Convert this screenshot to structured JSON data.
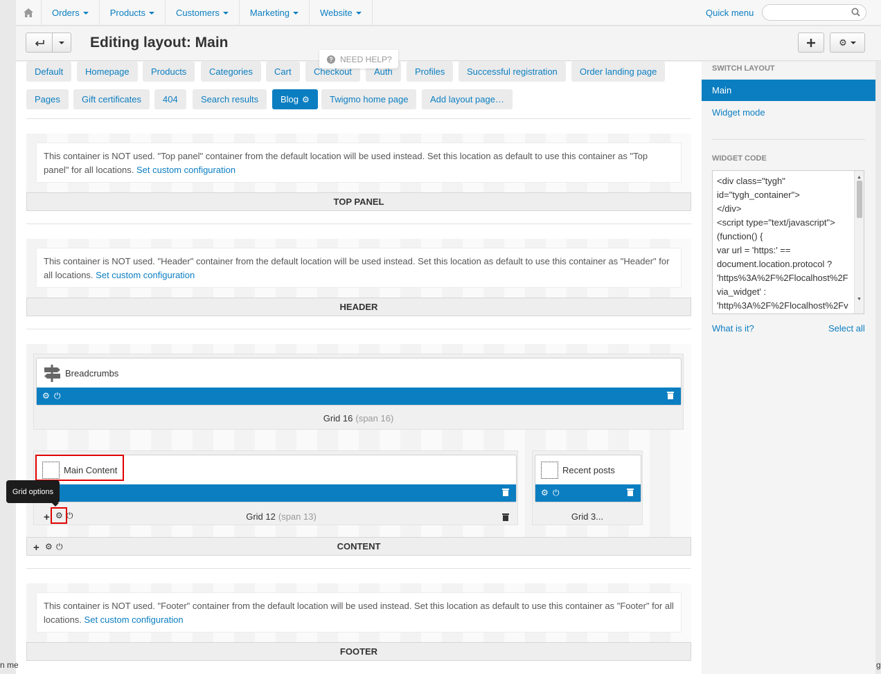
{
  "topnav": {
    "menu": [
      "Orders",
      "Products",
      "Customers",
      "Marketing",
      "Website"
    ],
    "quick_menu": "Quick menu",
    "search_placeholder": ""
  },
  "header": {
    "title": "Editing layout: Main",
    "need_help": "NEED HELP?"
  },
  "tabs": {
    "row1": [
      "Default",
      "Homepage",
      "Products",
      "Categories",
      "Cart",
      "Checkout",
      "Auth",
      "Profiles",
      "Successful registration",
      "Order landing page"
    ],
    "row2": [
      "Pages",
      "Gift certificates",
      "404",
      "Search results",
      "Blog",
      "Twigmo home page",
      "Add layout page…"
    ],
    "active": "Blog"
  },
  "containers": {
    "top_panel": {
      "notice": "This container is NOT used. \"Top panel\" container from the default location will be used instead. Set this location as default to use this container as \"Top panel\" for all locations.",
      "link": "Set custom configuration",
      "label": "TOP PANEL"
    },
    "header": {
      "notice": "This container is NOT used. \"Header\" container from the default location will be used instead. Set this location as default to use this container as \"Header\" for all locations.",
      "link": "Set custom configuration",
      "label": "HEADER"
    },
    "content": {
      "label": "CONTENT",
      "grids": [
        {
          "blocks": [
            "Breadcrumbs"
          ],
          "label": "Grid 16",
          "span": "(span 16)"
        },
        {
          "blocks": [
            "Main Content"
          ],
          "label": "Grid 12",
          "span": "(span 13)"
        },
        {
          "blocks": [
            "Recent posts"
          ],
          "label": "Grid 3..."
        }
      ]
    },
    "footer": {
      "notice": "This container is NOT used. \"Footer\" container from the default location will be used instead. Set this location as default to use this container as \"Footer\" for all locations.",
      "link": "Set custom configuration",
      "label": "FOOTER"
    }
  },
  "tooltip": "Grid options",
  "sidebar": {
    "switch_layout_title": "SWITCH LAYOUT",
    "layouts": [
      "Main",
      "Widget mode"
    ],
    "active_layout": "Main",
    "widget_code_title": "WIDGET CODE",
    "widget_code_lines": [
      "<div class=\"tygh\"",
      "id=\"tygh_container\">",
      "</div>",
      "<script type=\"text/javascript\">",
      "(function() {",
      "var url = 'https:' ==",
      "document.location.protocol ?",
      "'https%3A%2F%2Flocalhost%2F",
      "via_widget' :",
      "'http%3A%2F%2Flocalhost%2Fv"
    ],
    "what_is_it": "What is it?",
    "select_all": "Select all"
  },
  "edge_text": {
    "left": "n me",
    "right": "ge"
  },
  "colors": {
    "accent": "#0b7ec1",
    "highlight": "#e00000"
  }
}
